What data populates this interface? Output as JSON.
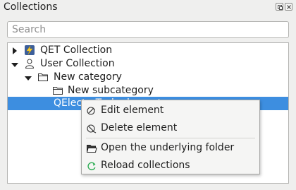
{
  "panel": {
    "title": "Collections",
    "float_button_icon": "float-icon",
    "close_button_icon": "close-icon"
  },
  "search": {
    "placeholder": "Search",
    "value": ""
  },
  "tree": {
    "items": [
      {
        "label": "QET Collection",
        "icon": "qet-lightning-icon",
        "expanded": false
      },
      {
        "label": "User Collection",
        "icon": "user-icon",
        "expanded": true
      },
      {
        "label": "New category",
        "icon": "folder-icon",
        "expanded": true
      },
      {
        "label": "New subcategory",
        "icon": "folder-icon",
        "expanded": false
      },
      {
        "label": "QElectroTech element",
        "icon": "element-icon",
        "selected": true
      }
    ]
  },
  "context_menu": {
    "items": [
      {
        "label": "Edit element",
        "icon": "edit-element-icon"
      },
      {
        "label": "Delete element",
        "icon": "delete-element-icon"
      },
      {
        "label": "Open the underlying folder",
        "icon": "open-folder-icon"
      },
      {
        "label": "Reload collections",
        "icon": "reload-icon"
      }
    ]
  },
  "colors": {
    "selection": "#3d8ee0",
    "background": "#efefee",
    "reload_accent": "#2fae56"
  }
}
